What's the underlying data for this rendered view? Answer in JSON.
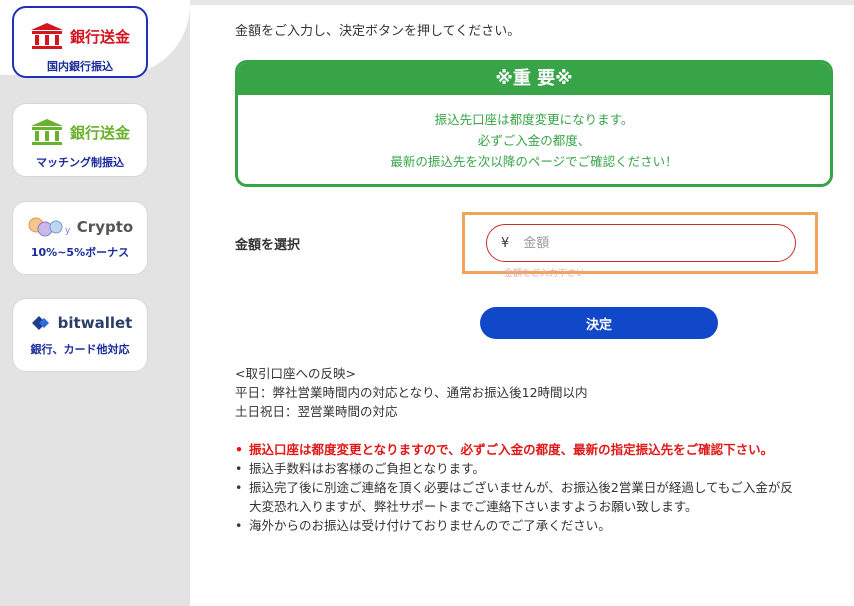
{
  "sidebar": {
    "items": [
      {
        "title": "銀行送金",
        "sub": "国内銀行振込",
        "active": true
      },
      {
        "title": "銀行送金",
        "sub": "マッチング制振込",
        "active": false
      },
      {
        "title": "Crypto",
        "sub": "10%~5%ボーナス",
        "active": false
      },
      {
        "title": "bitwallet",
        "sub": "銀行、カード他対応",
        "active": false
      }
    ]
  },
  "main": {
    "intro": "金額をご入力し、決定ボタンを押してください。",
    "notice": {
      "heading": "※重 要※",
      "lines": [
        "振込先口座は都度変更になります。",
        "必ずご入金の都度、",
        "最新の振込先を次以降のページでご確認ください！"
      ]
    },
    "amount": {
      "label": "金額を選択",
      "currency": "¥",
      "placeholder": "金額",
      "value": "",
      "error": "金額をご入力下さい"
    },
    "submit_label": "決定",
    "reflect": {
      "heading": "<取引口座への反映>",
      "weekday": "平日：弊社営業時間内の対応となり、通常お振込後12時間以内",
      "weekend": "土日祝日：翌営業時間の対応"
    },
    "notes": [
      "振込口座は都度変更となりますので、必ずご入金の都度、最新の指定振込先をご確認下さい。",
      "振込手数料はお客様のご負担となります。",
      "振込完了後に別途ご連絡を頂く必要はございませんが、お振込後2営業日が経過してもご入金が反",
      "大変恐れ入りますが、弊社サポートまでご連絡下さいますようお願い致します。",
      "海外からのお振込は受け付けておりませんのでご了承ください。"
    ]
  },
  "colors": {
    "accent_blue": "#1147c9",
    "notice_green": "#37a447",
    "bank_red": "#d4141e",
    "bank_green": "#6ab22d",
    "highlight_orange": "#f0a35a",
    "error_red": "#e01818"
  },
  "icons": [
    "bank-icon",
    "bank-icon",
    "crypto-coins-icon",
    "bitwallet-logo-icon"
  ]
}
